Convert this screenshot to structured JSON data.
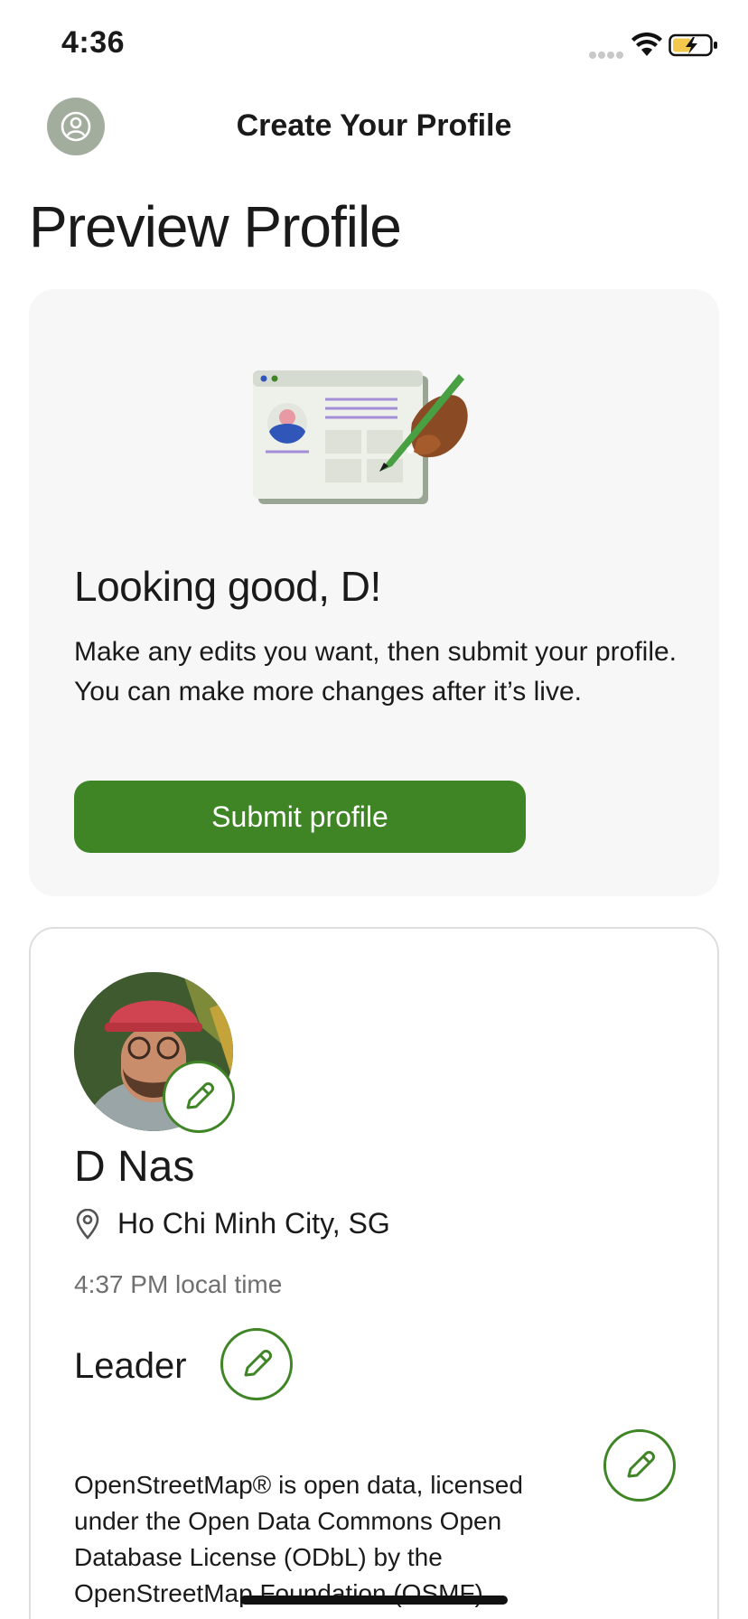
{
  "status_bar": {
    "time": "4:36"
  },
  "header": {
    "title": "Create Your Profile",
    "avatar_icon": "user-circle-icon"
  },
  "page": {
    "title": "Preview Profile"
  },
  "preview_card": {
    "heading": "Looking good, D!",
    "text": "Make any edits you want, then submit your profile. You can make more changes after it’s live.",
    "submit_label": "Submit profile"
  },
  "profile": {
    "name": "D Nas",
    "location": "Ho Chi Minh City,  SG",
    "local_time": "4:37 PM local time",
    "role": "Leader",
    "attribution": "OpenStreetMap® is open data, licensed under the Open Data Commons Open Database License (ODbL) by the OpenStreetMap Foundation (OSMF)."
  },
  "colors": {
    "accent": "#3f8526",
    "card_bg": "#f7f7f7",
    "avatar_bg": "#a3ad9e"
  }
}
